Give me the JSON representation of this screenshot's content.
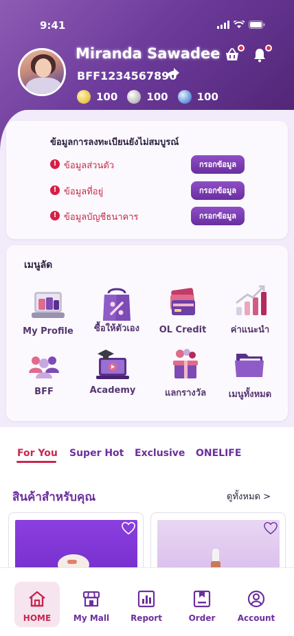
{
  "status_bar": {
    "time": "9:41"
  },
  "profile": {
    "name": "Miranda Sawadee",
    "member_id": "BFF1234567890",
    "coins": [
      {
        "type": "gold",
        "value": "100"
      },
      {
        "type": "silver",
        "value": "100"
      },
      {
        "type": "blue",
        "value": "100"
      }
    ]
  },
  "icons": {
    "cart": "basket-icon",
    "bell": "bell-icon",
    "share": "share-arrow-icon"
  },
  "registration": {
    "title": "ข้อมูลการลงทะเบียนยังไม่สมบูรณ์",
    "items": [
      {
        "label": "ข้อมูลส่วนตัว",
        "button": "กรอกข้อมูล"
      },
      {
        "label": "ข้อมูลที่อยู่",
        "button": "กรอกข้อมูล"
      },
      {
        "label": "ข้อมูลบัญชีธนาคาร",
        "button": "กรอกข้อมูล"
      }
    ]
  },
  "quick_menu": {
    "title": "เมนูลัด",
    "items": [
      {
        "label": "My Profile",
        "icon": "profile-icon"
      },
      {
        "label": "ซื้อให้ตัวเอง",
        "icon": "shopping-bag-icon"
      },
      {
        "label": "OL Credit",
        "icon": "credit-card-icon"
      },
      {
        "label": "ค่าแนะนำ",
        "icon": "growth-chart-icon"
      },
      {
        "label": "BFF",
        "icon": "people-icon"
      },
      {
        "label": "Academy",
        "icon": "academy-icon"
      },
      {
        "label": "แลกรางวัล",
        "icon": "gift-icon"
      },
      {
        "label": "เมนูทั้งหมด",
        "icon": "folder-icon"
      }
    ]
  },
  "tabs": [
    "For You",
    "Super Hot",
    "Exclusive",
    "ONELIFE"
  ],
  "products_section": {
    "title": "สินค้าสำหรับคุณ",
    "see_all": "ดูทั้งหมด >"
  },
  "bottom_nav": [
    {
      "label": "HOME",
      "icon": "home-icon",
      "active": true
    },
    {
      "label": "My Mall",
      "icon": "store-icon",
      "active": false
    },
    {
      "label": "Report",
      "icon": "report-icon",
      "active": false
    },
    {
      "label": "Order",
      "icon": "order-icon",
      "active": false
    },
    {
      "label": "Account",
      "icon": "account-icon",
      "active": false
    }
  ],
  "colors": {
    "primary": "#6b2f9e",
    "accent": "#c8264e",
    "background": "#f1ebfa"
  }
}
